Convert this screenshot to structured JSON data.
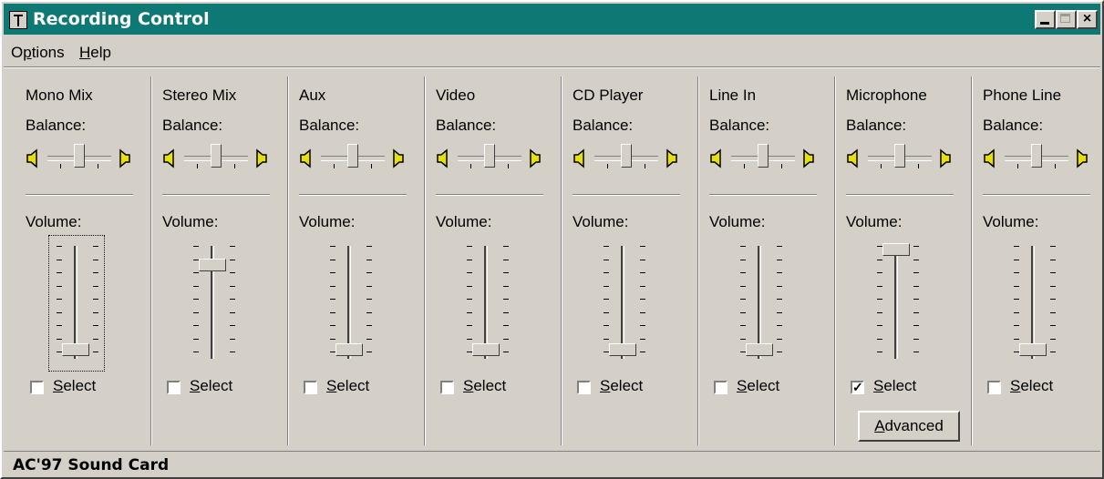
{
  "window": {
    "title": "Recording Control",
    "buttons": {
      "minimize": "_",
      "maximize": "□",
      "close": "×"
    }
  },
  "menu": [
    {
      "label": "Options",
      "mnemonic_index": 1
    },
    {
      "label": "Help",
      "mnemonic_index": 0
    }
  ],
  "balance_label": "Balance:",
  "volume_label": "Volume:",
  "select_label": "Select",
  "advanced_label": "Advanced",
  "channels": [
    {
      "name": "Mono Mix",
      "volume": 0.0,
      "selected": false
    },
    {
      "name": "Stereo Mix",
      "volume": 0.85,
      "selected": false
    },
    {
      "name": "Aux",
      "volume": 0.0,
      "selected": false
    },
    {
      "name": "Video",
      "volume": 0.0,
      "selected": false
    },
    {
      "name": "CD Player",
      "volume": 0.0,
      "selected": false
    },
    {
      "name": "Line In",
      "volume": 0.0,
      "selected": false
    },
    {
      "name": "Microphone",
      "volume": 1.0,
      "selected": true
    },
    {
      "name": "Phone Line",
      "volume": 0.0,
      "selected": false
    }
  ],
  "status_bar": "AC'97 Sound Card",
  "colors": {
    "titlebar": "#0e7874",
    "face": "#d4d0c8",
    "speaker": "#e8e000"
  }
}
